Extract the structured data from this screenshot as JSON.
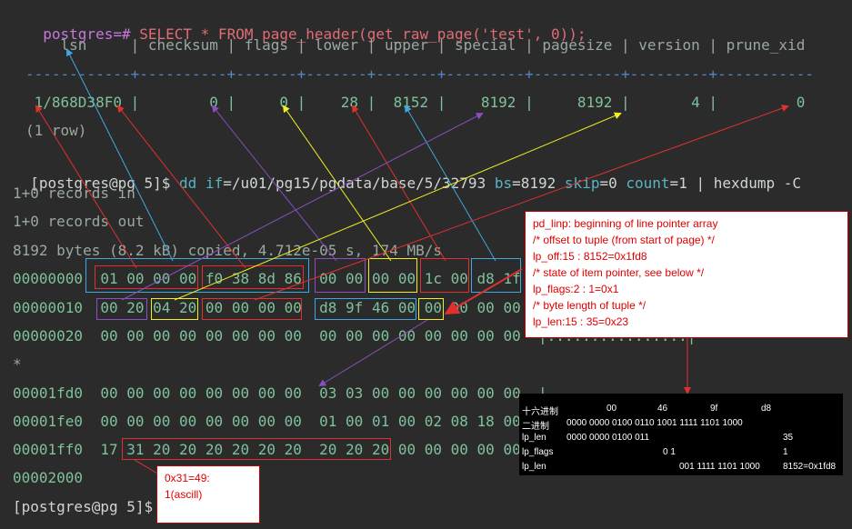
{
  "terminal": {
    "sql_prompt": "postgres=#",
    "sql_cmd": "SELECT * FROM page_header(get_raw_page('test', 0));",
    "header_row": "    lsn     | checksum | flags | lower | upper | special | pagesize | version | prune_xid",
    "separator": "------------+----------+-------+-------+-------+---------+----------+---------+-----------",
    "values_row": " 1/868D38F0 |        0 |     0 |    28 |  8152 |    8192 |     8192 |       4 |         0",
    "row_count": "(1 row)",
    "shell_prompt": "[postgres@pg 5]$",
    "dd_cmd": "dd",
    "dd_if_key": "if",
    "dd_if_val": "/u01/pg15/pgdata/base/5/32793",
    "dd_bs_key": "bs",
    "dd_bs_val": "8192",
    "dd_skip_key": "skip",
    "dd_skip_val": "0",
    "dd_count_key": "count",
    "dd_count_val": "1",
    "dd_pipe": "| hexdump -C",
    "records_in": "1+0 records in",
    "records_out": "1+0 records out",
    "copied": "8192 bytes (8.2 kB) copied, 4.712e-05 s, 174 MB/s",
    "hex_lines": [
      "00000000  01 00 00 00 f0 38 8d 86  00 00 00 00 1c 00 d8 1f",
      "00000010  00 20 04 20 00 00 00 00  d8 9f 46 00 00 00 00 00",
      "00000020  00 00 00 00 00 00 00 00  00 00 00 00 00 00 00 00  |................|",
      "*",
      "00001fd0  00 00 00 00 00 00 00 00  03 03 00 00 00 00 00 00  |",
      "00001fe0  00 00 00 00 00 00 00 00  01 00 01 00 02 08 18 00",
      "00001ff0  17 31 20 20 20 20 20 20  20 20 20 00 00 00 00 00",
      "00002000"
    ],
    "final_prompt": "[postgres@pg 5]$"
  },
  "annotations": {
    "linp_note": [
      "pd_linp: beginning of line pointer array",
      "/* offset to tuple (from start of page) */",
      "lp_off:15 :  8152=0x1fd8",
      "/* state of item pointer, see below */",
      "lp_flags:2 : 1=0x1",
      "/* byte length of tuple */",
      "lp_len:15 :  35=0x23"
    ],
    "ascii_note": [
      "0x31=49:",
      "1(ascill)"
    ]
  },
  "bits_table": {
    "header": [
      "十六进制",
      "00",
      "46",
      "9f",
      "d8"
    ],
    "binary": [
      "二进制",
      "0000 0000 0100 0110 1001 1111 1101 1000"
    ],
    "lp_len": [
      "lp_len",
      "0000 0000 0100 011",
      "35"
    ],
    "lp_flags": [
      "lp_flags",
      "0 1",
      "1"
    ],
    "lp_len2": [
      "lp_len",
      "001 1111 1101 1000",
      "8152=0x1fd8"
    ]
  },
  "colors": {
    "background": "#2b2b2b",
    "blue": "#3fa8e0",
    "red": "#e03030",
    "purple": "#8a4fc0",
    "yellow": "#f0f020"
  }
}
